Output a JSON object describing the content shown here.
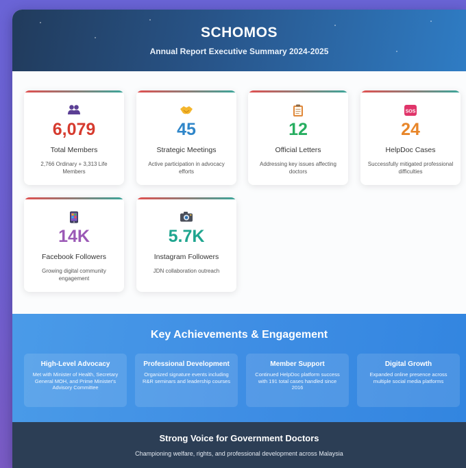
{
  "header": {
    "title": "SCHOMOS",
    "subtitle": "Annual Report Executive Summary 2024-2025"
  },
  "stats": [
    {
      "icon": "members-icon",
      "color": "#d63b2f",
      "value": "6,079",
      "label": "Total Members",
      "desc": "2,766 Ordinary + 3,313 Life Members"
    },
    {
      "icon": "handshake-icon",
      "color": "#2f86c9",
      "value": "45",
      "label": "Strategic Meetings",
      "desc": "Active participation in advocacy efforts"
    },
    {
      "icon": "clipboard-icon",
      "color": "#27ae60",
      "value": "12",
      "label": "Official Letters",
      "desc": "Addressing key issues affecting doctors"
    },
    {
      "icon": "sos-icon",
      "color": "#e8862a",
      "value": "24",
      "label": "HelpDoc Cases",
      "desc": "Successfully mitigated professional difficulties"
    },
    {
      "icon": "mobile-phone-icon",
      "color": "#9b59b6",
      "value": "14K",
      "label": "Facebook Followers",
      "desc": "Growing digital community engagement"
    },
    {
      "icon": "camera-icon",
      "color": "#1fa58f",
      "value": "5.7K",
      "label": "Instagram Followers",
      "desc": "JDN collaboration outreach"
    }
  ],
  "achievements": {
    "title": "Key Achievements & Engagement",
    "items": [
      {
        "title": "High-Level Advocacy",
        "desc": "Met with Minister of Health, Secretary General MOH, and Prime Minister's Advisory Committee"
      },
      {
        "title": "Professional Development",
        "desc": "Organized signature events including R&R seminars and leadership courses"
      },
      {
        "title": "Member Support",
        "desc": "Continued HelpDoc platform success with 191 total cases handled since 2016"
      },
      {
        "title": "Digital Growth",
        "desc": "Expanded online presence across multiple social media platforms"
      }
    ]
  },
  "footer": {
    "title": "Strong Voice for Government Doctors",
    "subtitle": "Championing welfare, rights, and professional development across Malaysia"
  }
}
